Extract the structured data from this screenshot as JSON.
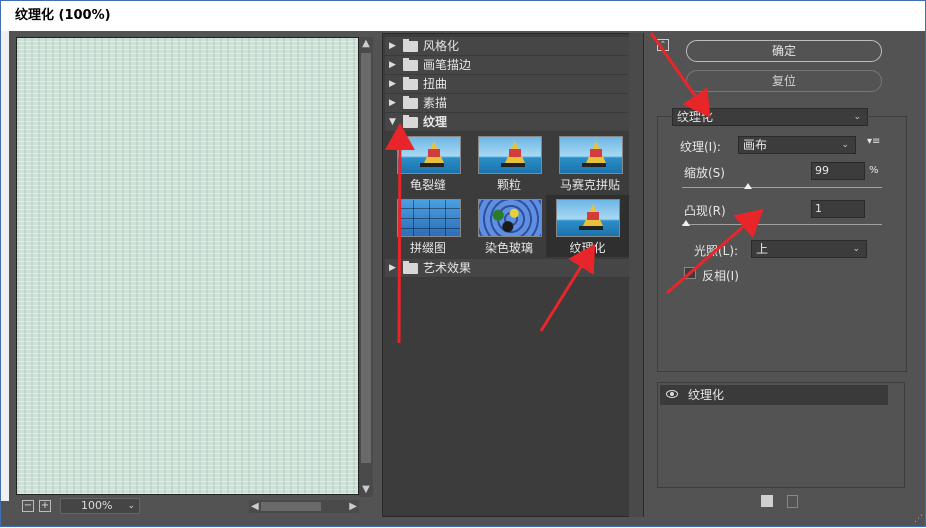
{
  "window": {
    "title": "纹理化 (100%)"
  },
  "preview": {
    "zoom": "100%",
    "zoom_out": "−",
    "zoom_in": "+",
    "scroll_up": "▲",
    "scroll_down": "▼",
    "scroll_left": "◀",
    "scroll_right": "▶"
  },
  "filters": {
    "categories": [
      {
        "label": "风格化",
        "open": false
      },
      {
        "label": "画笔描边",
        "open": false
      },
      {
        "label": "扭曲",
        "open": false
      },
      {
        "label": "素描",
        "open": false
      },
      {
        "label": "纹理",
        "open": true
      },
      {
        "label": "艺术效果",
        "open": false
      }
    ],
    "texture_items": [
      {
        "label": "龟裂缝",
        "selected": false
      },
      {
        "label": "颗粒",
        "selected": false
      },
      {
        "label": "马赛克拼贴",
        "selected": false
      },
      {
        "label": "拼缀图",
        "selected": false
      },
      {
        "label": "染色玻璃",
        "selected": false
      },
      {
        "label": "纹理化",
        "selected": true
      }
    ]
  },
  "buttons": {
    "ok": "确定",
    "reset": "复位"
  },
  "settings": {
    "filter_select": "纹理化",
    "texture_label": "纹理(I):",
    "texture_value": "画布",
    "scale_label": "缩放(S)",
    "scale_value": "99",
    "scale_unit": "%",
    "scale_level": 0.33,
    "relief_label": "凸现(R)",
    "relief_value": "1",
    "relief_level": 0.02,
    "light_label": "光照(L):",
    "light_value": "上",
    "invert_label": "反相(I)",
    "invert_checked": false
  },
  "layers": {
    "items": [
      {
        "label": "纹理化",
        "visible": true
      }
    ]
  },
  "colors": {
    "dialog_bg": "#535353",
    "panel_bg": "#3c3c3c",
    "preview_bg": "#cfe2d8",
    "annotation_arrow": "#e8262a"
  }
}
